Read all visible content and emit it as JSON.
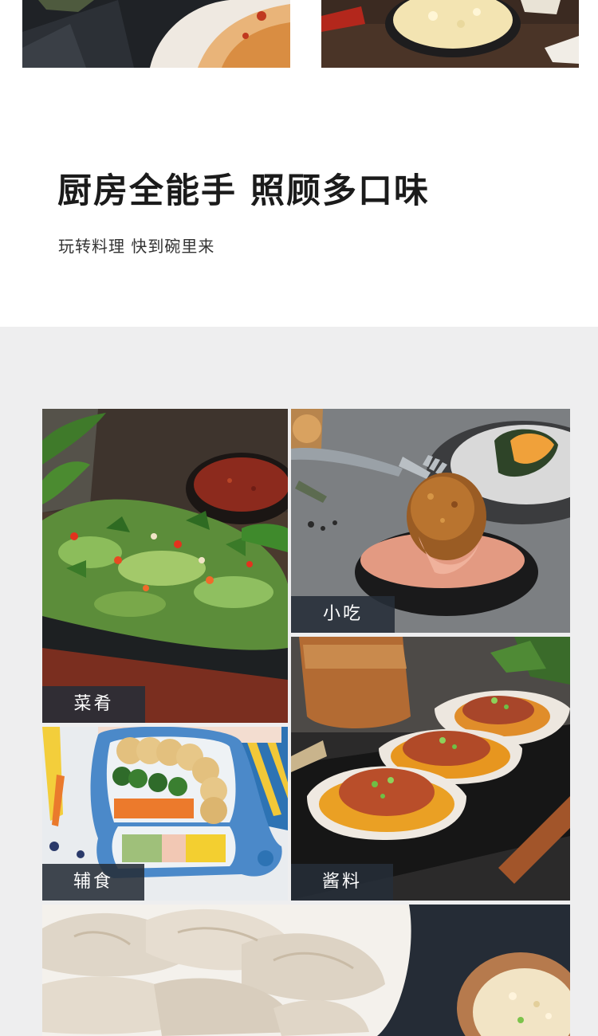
{
  "header": {
    "title": "厨房全能手 照顾多口味",
    "subtitle": "玩转料理 快到碗里来"
  },
  "gallery": {
    "items": [
      {
        "label": "菜肴"
      },
      {
        "label": "小吃"
      },
      {
        "label": "辅食"
      },
      {
        "label": "酱料"
      }
    ]
  },
  "colors": {
    "panel_background": "#eeeeef",
    "label_background": "#262d38",
    "label_text": "#ffffff",
    "headline_text": "#1b1b1b"
  }
}
